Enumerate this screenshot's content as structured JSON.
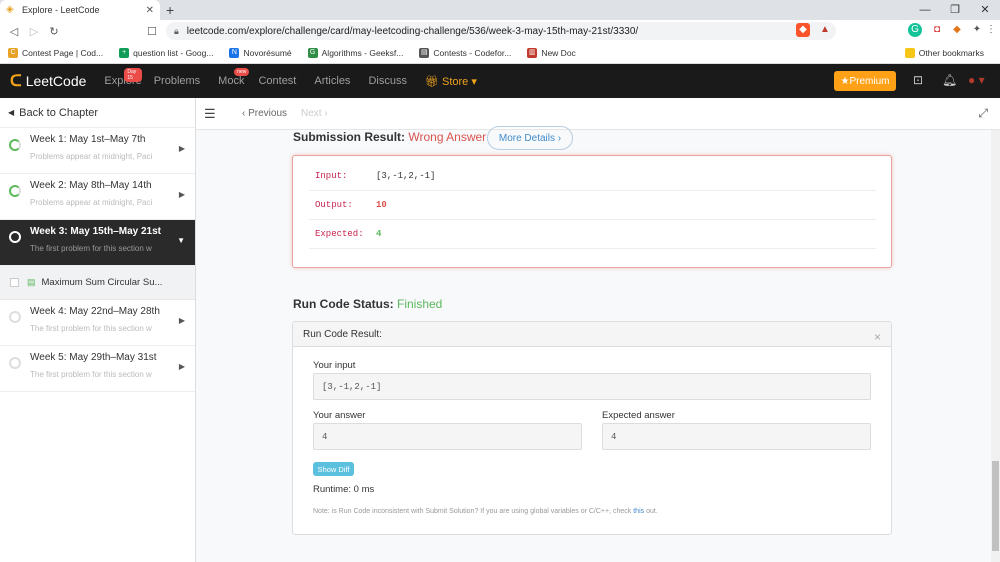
{
  "browser": {
    "tab_title": "Explore - LeetCode",
    "url": "leetcode.com/explore/challenge/card/may-leetcoding-challenge/536/week-3-may-15th-may-21st/3330/"
  },
  "bookmarks": [
    {
      "label": "Contest Page | Cod...",
      "color": "#e8a227",
      "glyph": "C"
    },
    {
      "label": "question list - Goog...",
      "color": "#0f9d58",
      "glyph": "+"
    },
    {
      "label": "Novorésumé",
      "color": "#1a73e8",
      "glyph": "N"
    },
    {
      "label": "Algorithms - Geeksf...",
      "color": "#2f8d46",
      "glyph": "G"
    },
    {
      "label": "Contests - Codefor...",
      "color": "#555",
      "glyph": "▤"
    },
    {
      "label": "New Doc",
      "color": "#c0392b",
      "glyph": "▥"
    }
  ],
  "other_bookmarks": "Other bookmarks",
  "lcnav": {
    "brand": "LeetCode",
    "items": [
      "Explore",
      "Problems",
      "Mock",
      "Contest",
      "Articles",
      "Discuss"
    ],
    "explore_badge": "Day 15",
    "mock_badge": "new",
    "store": "Store",
    "premium": "Premium"
  },
  "sidebar": {
    "back": "Back to Chapter",
    "weeks": [
      {
        "title": "Week 1: May 1st–May 7th",
        "sub": "Problems appear at midnight, Pacif"
      },
      {
        "title": "Week 2: May 8th–May 14th",
        "sub": "Problems appear at midnight, Pacif"
      },
      {
        "title": "Week 3: May 15th–May 21st",
        "sub": "The first problem for this section w"
      },
      {
        "title": "Week 4: May 22nd–May 28th",
        "sub": "The first problem for this section w"
      },
      {
        "title": "Week 5: May 29th–May 31st",
        "sub": "The first problem for this section w"
      }
    ],
    "subitem": "Maximum Sum Circular Su..."
  },
  "toolbar": {
    "prev": "Previous",
    "next": "Next"
  },
  "submission": {
    "label": "Submission Result: ",
    "status": "Wrong Answer",
    "more": "More Details",
    "input_k": "Input:",
    "input_v": "[3,-1,2,-1]",
    "output_k": "Output:",
    "output_v": "10",
    "expected_k": "Expected:",
    "expected_v": "4"
  },
  "runcode": {
    "label": "Run Code Status: ",
    "status": "Finished",
    "header": "Run Code Result:",
    "your_input_label": "Your input",
    "your_input": "[3,-1,2,-1]",
    "your_answer_label": "Your answer",
    "your_answer": "4",
    "expected_label": "Expected answer",
    "expected": "4",
    "show_diff": "Show Diff",
    "runtime": "Runtime: 0 ms",
    "note": "Note: is Run Code inconsistent with Submit Solution? If you are using global variables or C/C++, check ",
    "note_link": "this",
    "note_end": " out."
  }
}
